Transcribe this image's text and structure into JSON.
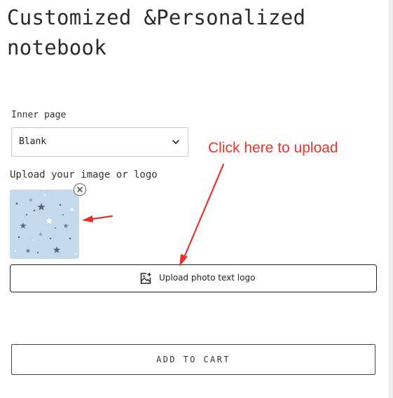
{
  "product": {
    "title": "Customized &Personalized notebook"
  },
  "options": {
    "inner_page_label": "Inner page",
    "inner_page_selected": "Blank"
  },
  "upload": {
    "label": "Upload your image or logo",
    "button_label": "Upload photo text logo",
    "thumbnail_icon": "stars-pattern-image",
    "remove_icon": "close-circle-icon",
    "upload_icon": "image-upload-icon"
  },
  "annotation": {
    "text": "Click here to upload",
    "color": "#e5322c"
  },
  "cart": {
    "button_label": "ADD TO CART"
  },
  "colors": {
    "thumbnail_background": "#c4daea",
    "text": "#222222"
  }
}
